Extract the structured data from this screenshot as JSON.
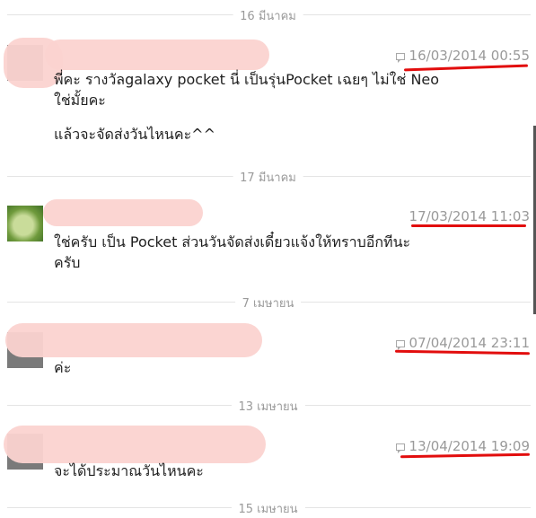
{
  "colors": {
    "separator_text": "#9a9a9a",
    "timestamp_text": "#9a9a9a",
    "message_text": "#1f1f1f",
    "redaction": "#fbd3d0",
    "annotation_underline": "#e20d0d"
  },
  "date_separators": [
    "16 มีนาคม",
    "17 มีนาคม",
    "7 เมษายน",
    "13 เมษายน",
    "15 เมษายน"
  ],
  "messages": [
    {
      "timestamp": "16/03/2014 00:55",
      "lines": [
        "พี่คะ รางวัลgalaxy pocket นี่ เป็นรุ่นPocket เฉยๆ ไม่ใช่ Neo",
        "ใช่มั้ยคะ",
        "แล้วจะจัดส่งวันไหนคะ^^"
      ]
    },
    {
      "timestamp": "17/03/2014 11:03",
      "lines": [
        "ใช่ครับ เป็น Pocket ส่วนวันจัดส่งเดี๋ยวแจ้งให้ทราบอีกทีนะ",
        "ครับ"
      ]
    },
    {
      "timestamp": "07/04/2014 23:11",
      "lines": [
        "ค่ะ"
      ]
    },
    {
      "timestamp": "13/04/2014 19:09",
      "lines": [
        "จะได้ประมาณวันไหนคะ"
      ]
    }
  ]
}
